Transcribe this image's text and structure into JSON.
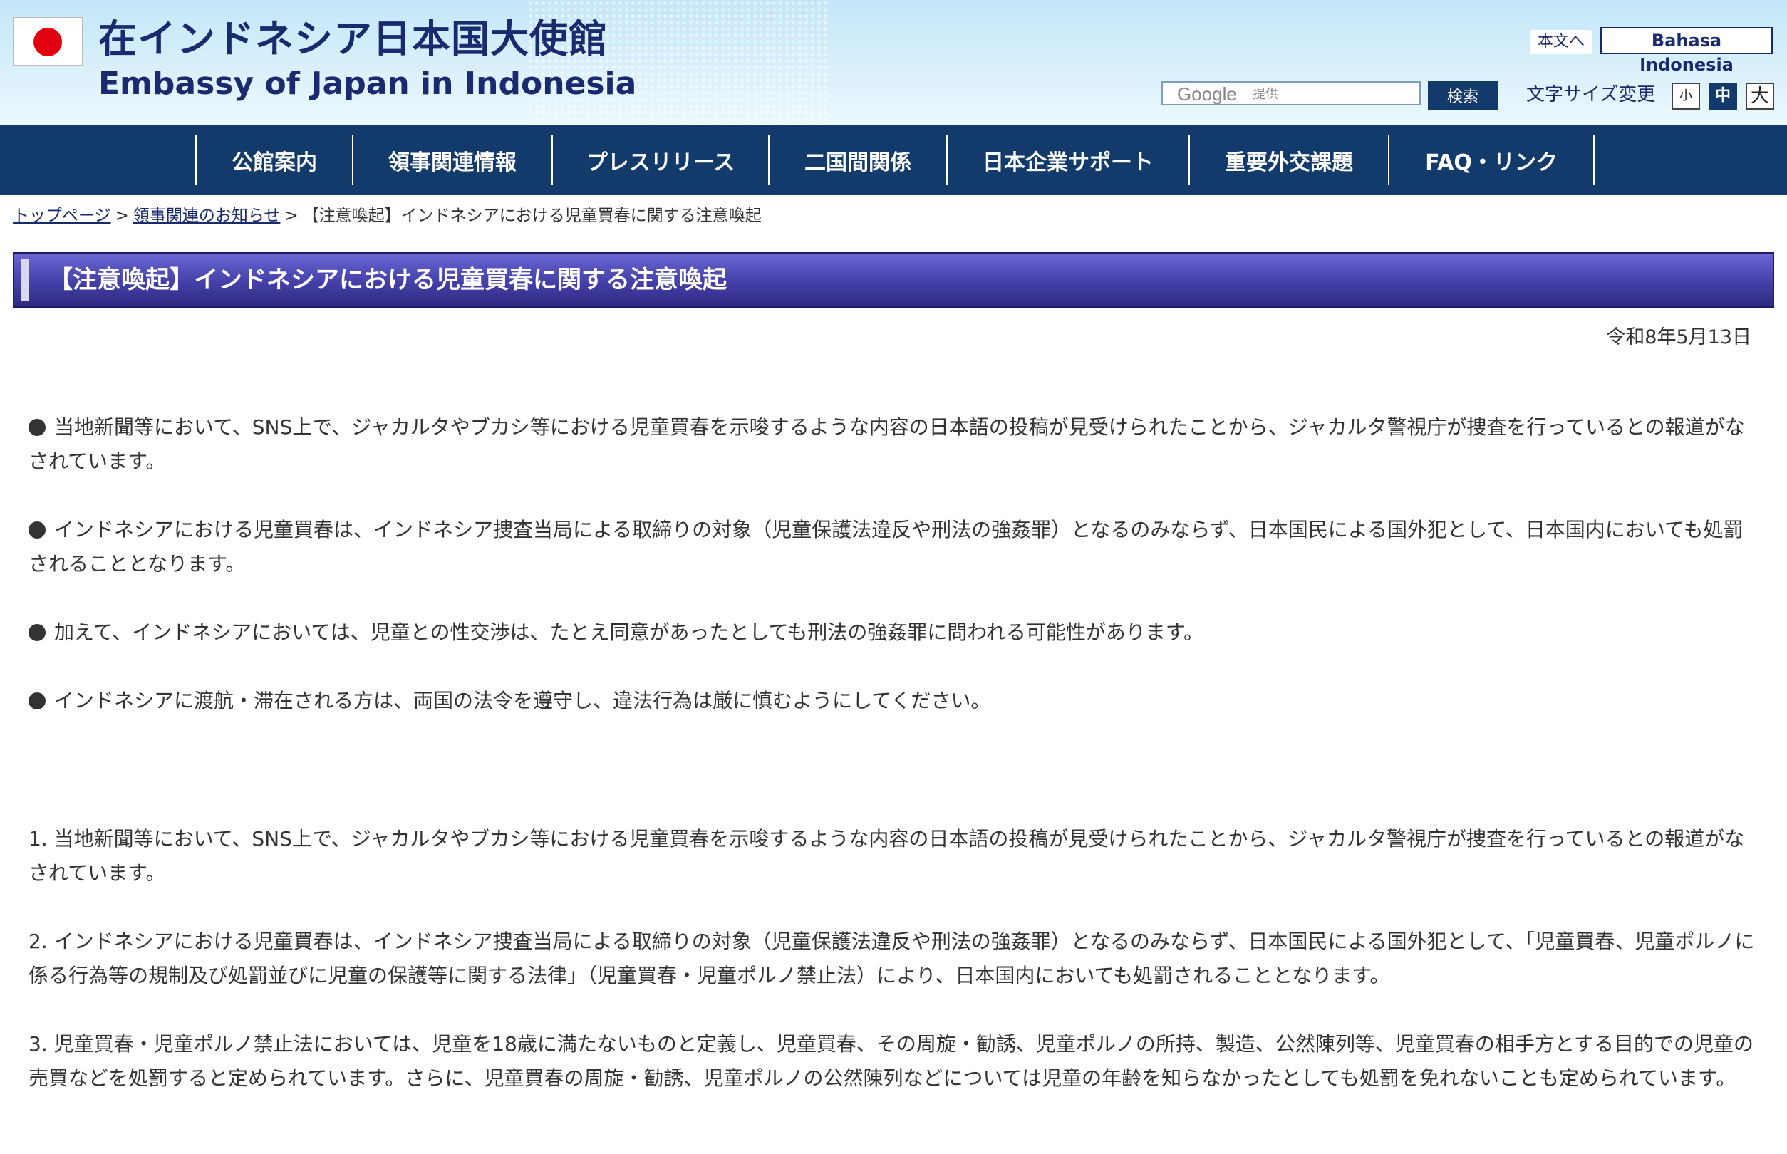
{
  "header": {
    "title_ja": "在インドネシア日本国大使館",
    "title_en": "Embassy of Japan in Indonesia",
    "skip_link": "本文へ",
    "language_link": "Bahasa Indonesia",
    "search": {
      "brand": "Google",
      "brand_suffix": "提供",
      "value": "",
      "button": "検索"
    },
    "font_size": {
      "label": "文字サイズ変更",
      "small": "小",
      "medium": "中",
      "large": "大",
      "selected": "中"
    }
  },
  "nav": {
    "items": [
      {
        "label": "公館案内"
      },
      {
        "label": "領事関連情報"
      },
      {
        "label": "プレスリリース"
      },
      {
        "label": "二国間関係"
      },
      {
        "label": "日本企業サポート"
      },
      {
        "label": "重要外交課題"
      },
      {
        "label": "FAQ・リンク"
      }
    ]
  },
  "breadcrumb": {
    "items": [
      "トップページ",
      "領事関連のお知らせ"
    ],
    "separator": ">",
    "current": "【注意喚起】インドネシアにおける児童買春に関する注意喚起"
  },
  "page": {
    "title": "【注意喚起】インドネシアにおける児童買春に関する注意喚起",
    "date": "令和8年5月13日",
    "bullets": [
      "当地新聞等において、SNS上で、ジャカルタやブカシ等における児童買春を示唆するような内容の日本語の投稿が見受けられたことから、ジャカルタ警視庁が捜査を行っているとの報道がなされています。",
      "インドネシアにおける児童買春は、インドネシア捜査当局による取締りの対象（児童保護法違反や刑法の強姦罪）となるのみならず、日本国民による国外犯として、日本国内においても処罰されることとなります。",
      "加えて、インドネシアにおいては、児童との性交渉は、たとえ同意があったとしても刑法の強姦罪に問われる可能性があります。",
      "インドネシアに渡航・滞在される方は、両国の法令を遵守し、違法行為は厳に慎むようにしてください。"
    ],
    "numbered": [
      "1.  当地新聞等において、SNS上で、ジャカルタやブカシ等における児童買春を示唆するような内容の日本語の投稿が見受けられたことから、ジャカルタ警視庁が捜査を行っているとの報道がなされています。",
      "2.  インドネシアにおける児童買春は、インドネシア捜査当局による取締りの対象（児童保護法違反や刑法の強姦罪）となるのみならず、日本国民による国外犯として、「児童買春、児童ポルノに係る行為等の規制及び処罰並びに児童の保護等に関する法律」（児童買春・児童ポルノ禁止法）により、日本国内においても処罰されることとなります。",
      "3.  児童買春・児童ポルノ禁止法においては、児童を18歳に満たないものと定義し、児童買春、その周旋・勧誘、児童ポルノの所持、製造、公然陳列等、児童買春の相手方とする目的での児童の売買などを処罰すると定められています。さらに、児童買春の周旋・勧誘、児童ポルノの公然陳列などについては児童の年齢を知らなかったとしても処罰を免れないことも定められています。"
    ]
  },
  "colors": {
    "brand_navy": "#123a6a",
    "title_text": "#1a2a6e",
    "title_bar": "#4440a8",
    "flag_red": "#e00010"
  }
}
